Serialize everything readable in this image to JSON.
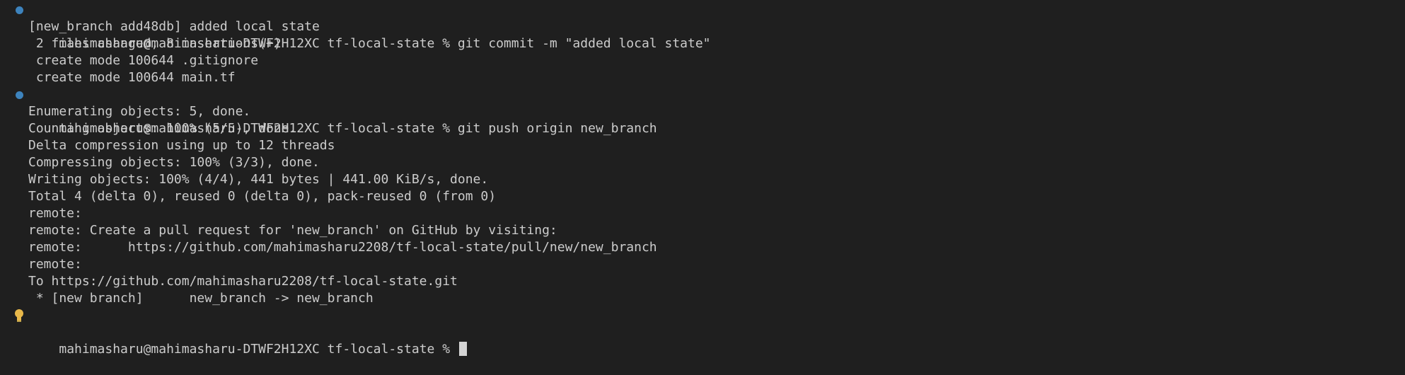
{
  "terminal": {
    "colors": {
      "background": "#1f1f1f",
      "text": "#cccccc",
      "prompt_dot": "#3d83bd",
      "lightbulb": "#e8b84a",
      "cursor": "#d4d4d4"
    },
    "icons": {
      "command_marker": "command-decoration-dot-icon",
      "hint": "lightbulb-icon"
    },
    "lines": [
      "mahimasharu@mahimasharu-DTWF2H12XC tf-local-state % git commit -m \"added local state\"",
      "[new_branch add48db] added local state",
      " 2 files changed, 8 insertions(+)",
      " create mode 100644 .gitignore",
      " create mode 100644 main.tf",
      "mahimasharu@mahimasharu-DTWF2H12XC tf-local-state % git push origin new_branch",
      "Enumerating objects: 5, done.",
      "Counting objects: 100% (5/5), done.",
      "Delta compression using up to 12 threads",
      "Compressing objects: 100% (3/3), done.",
      "Writing objects: 100% (4/4), 441 bytes | 441.00 KiB/s, done.",
      "Total 4 (delta 0), reused 0 (delta 0), pack-reused 0 (from 0)",
      "remote:",
      "remote: Create a pull request for 'new_branch' on GitHub by visiting:",
      "remote:      https://github.com/mahimasharu2208/tf-local-state/pull/new/new_branch",
      "remote:",
      "To https://github.com/mahimasharu2208/tf-local-state.git",
      " * [new branch]      new_branch -> new_branch",
      "mahimasharu@mahimasharu-DTWF2H12XC tf-local-state % "
    ]
  }
}
